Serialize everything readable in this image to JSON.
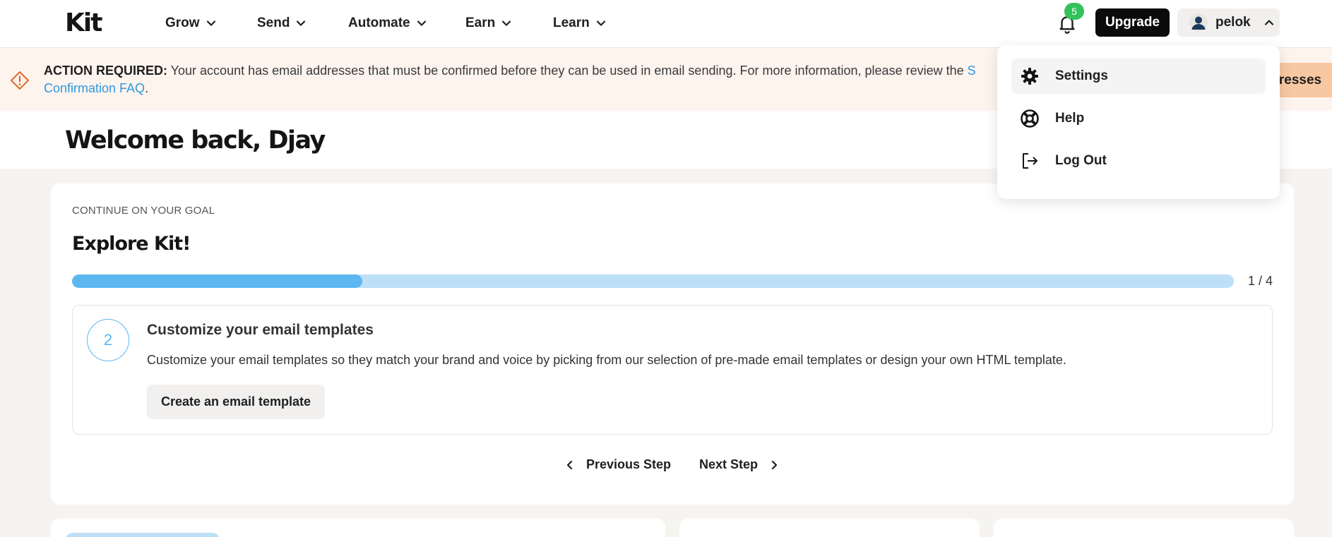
{
  "brand": {
    "logo_text": "Kit"
  },
  "nav": {
    "items": [
      {
        "label": "Grow"
      },
      {
        "label": "Send"
      },
      {
        "label": "Automate"
      },
      {
        "label": "Earn"
      },
      {
        "label": "Learn"
      }
    ]
  },
  "header": {
    "notifications_count": "5",
    "upgrade_label": "Upgrade",
    "username": "pelok"
  },
  "alert": {
    "prefix": "ACTION REQUIRED:",
    "message": " Your account has email addresses that must be confirmed before they can be used in email sending. For more information, please review the ",
    "link_start": "S",
    "link_rest": "Confirmation FAQ",
    "suffix": ".",
    "button_label": "ldresses"
  },
  "welcome": {
    "title": "Welcome back, Djay"
  },
  "goal": {
    "kicker": "CONTINUE ON YOUR GOAL",
    "title": "Explore Kit!",
    "progress_fraction": 0.25,
    "progress_label": "1 / 4",
    "step": {
      "number": "2",
      "title": "Customize your email templates",
      "description": "Customize your email templates so they match your brand and voice by picking from our selection of pre-made email templates or design your own HTML template.",
      "button_label": "Create an email template"
    },
    "prev_label": "Previous Step",
    "next_label": "Next Step"
  },
  "account_menu": {
    "items": [
      {
        "label": "Settings",
        "icon": "gear-icon"
      },
      {
        "label": "Help",
        "icon": "lifebuoy-icon"
      },
      {
        "label": "Log Out",
        "icon": "logout-icon"
      }
    ]
  },
  "colors": {
    "accent_blue": "#5cb6f0",
    "progress_track": "#bde0f7",
    "alert_bg": "#fef4ee",
    "alert_icon": "#e06a2e",
    "badge_green": "#34c25a"
  }
}
